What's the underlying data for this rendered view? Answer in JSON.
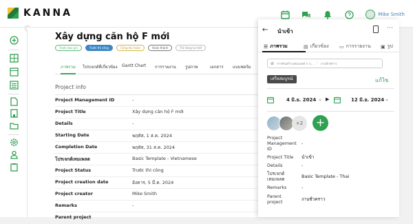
{
  "app": {
    "logo_text": "KANNA",
    "user_name": "Mike Smith",
    "accent": "#3aa55d"
  },
  "project": {
    "title": "Xây dựng căn hộ F mới",
    "steps": [
      "Trước báo giá",
      "Trước thi công",
      "Công tác hoàn",
      "Hoàn thành",
      "Trả hàng tự mất"
    ],
    "tabs": [
      "ภาพรวม",
      "โปรเจกต์ที่เกี่ยวข้อง",
      "Gantt Chart",
      "การรายงาน",
      "รูปภาพ",
      "เอกสาร",
      "แบบฟอร์ม"
    ],
    "section_title": "Project info",
    "rows": [
      {
        "label": "Project Management ID",
        "value": "-"
      },
      {
        "label": "Project Title",
        "value": "Xây dựng căn hộ F mới"
      },
      {
        "label": "Details",
        "value": "-"
      },
      {
        "label": "Starting Date",
        "value": "พฤหัส, 1 ส.ค. 2024"
      },
      {
        "label": "Completion Date",
        "value": "พฤหัส, 31 ส.ค. 2024"
      },
      {
        "label": "โปรเจกต์เทมเพลต",
        "value": "Basic Template - Vietnamese"
      },
      {
        "label": "Project Status",
        "value": "Trước thi công"
      },
      {
        "label": "Project creation date",
        "value": "อังคาร, 5 มี.ค. 2024"
      },
      {
        "label": "Project creator",
        "value": "Mike Smith"
      },
      {
        "label": "Remarks",
        "value": "-"
      },
      {
        "label": "Parent project",
        "value": ""
      }
    ]
  },
  "panel": {
    "title": "นำเข้า",
    "tabs": [
      "ภาพรวม",
      "เกี่ยวข้อง",
      "การรายงาน",
      "รูป"
    ],
    "search_placeholder": "การค้นสร้างเทมเพลต์ ก ป...",
    "search_value": "งานชั่วคราว",
    "status": "เสร็จสมบูรณ์",
    "edit_label": "แก้ไข",
    "start_date": "4 มิ.ย. 2024",
    "end_date": "12 มิ.ย. 2024",
    "more_members": "+2",
    "add_label": "+",
    "rows": [
      {
        "label": "Project Management ID",
        "value": "-"
      },
      {
        "label": "Project Title",
        "value": "นำเข้า"
      },
      {
        "label": "Details",
        "value": "-"
      },
      {
        "label": "โปรเจกต์เทมเพลต",
        "value": "Basic Template - Thai"
      },
      {
        "label": "Remarks",
        "value": "-"
      },
      {
        "label": "Parent project",
        "value": "งานชั่วคราว"
      }
    ]
  },
  "icons": {
    "top": [
      "calendar-icon",
      "chat-icon",
      "bell-icon",
      "help-icon"
    ],
    "sidebar": [
      "add-icon",
      "grid-icon",
      "board-icon",
      "list-icon",
      "document-icon",
      "building-icon",
      "folder-icon",
      "settings-icon",
      "user-icon",
      "clipboard-icon"
    ]
  }
}
